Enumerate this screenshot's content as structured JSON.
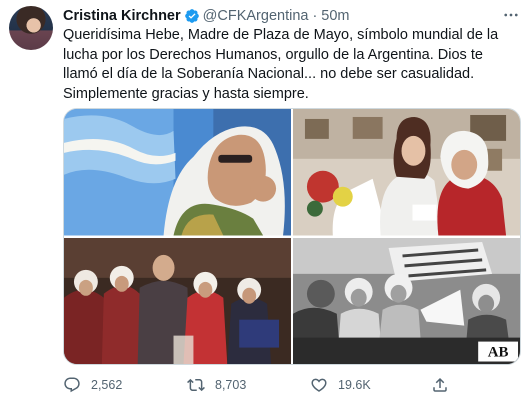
{
  "tweet": {
    "author": {
      "display_name": "Cristina Kirchner",
      "verified": true,
      "handle": "@CFKArgentina",
      "separator": "·",
      "time": "50m"
    },
    "text": "Queridísima Hebe, Madre de Plaza de Mayo, símbolo mundial de la lucha por los Derechos Humanos, orgullo de la Argentina. Dios te llamó el día de la Soberanía Nacional... no debe ser casualidad. Simplemente gracias y hasta siempre.",
    "media": {
      "photos": [
        {
          "alt": "",
          "sign_text": ""
        },
        {
          "alt": "",
          "sign_text": ""
        },
        {
          "alt": "",
          "sign_text": ""
        },
        {
          "alt": "",
          "sign_text": "AB"
        }
      ]
    },
    "actions": {
      "replies": "2,562",
      "retweets": "8,703",
      "likes": "19.6K"
    }
  },
  "icons": {
    "verified": "verified-badge-icon",
    "more": "more-options-icon",
    "reply": "reply-icon",
    "retweet": "retweet-icon",
    "like": "heart-icon",
    "share": "share-icon"
  },
  "colors": {
    "text": "#0f1419",
    "secondary": "#536471",
    "verified": "#1d9bf0",
    "border": "#cfd9de"
  }
}
